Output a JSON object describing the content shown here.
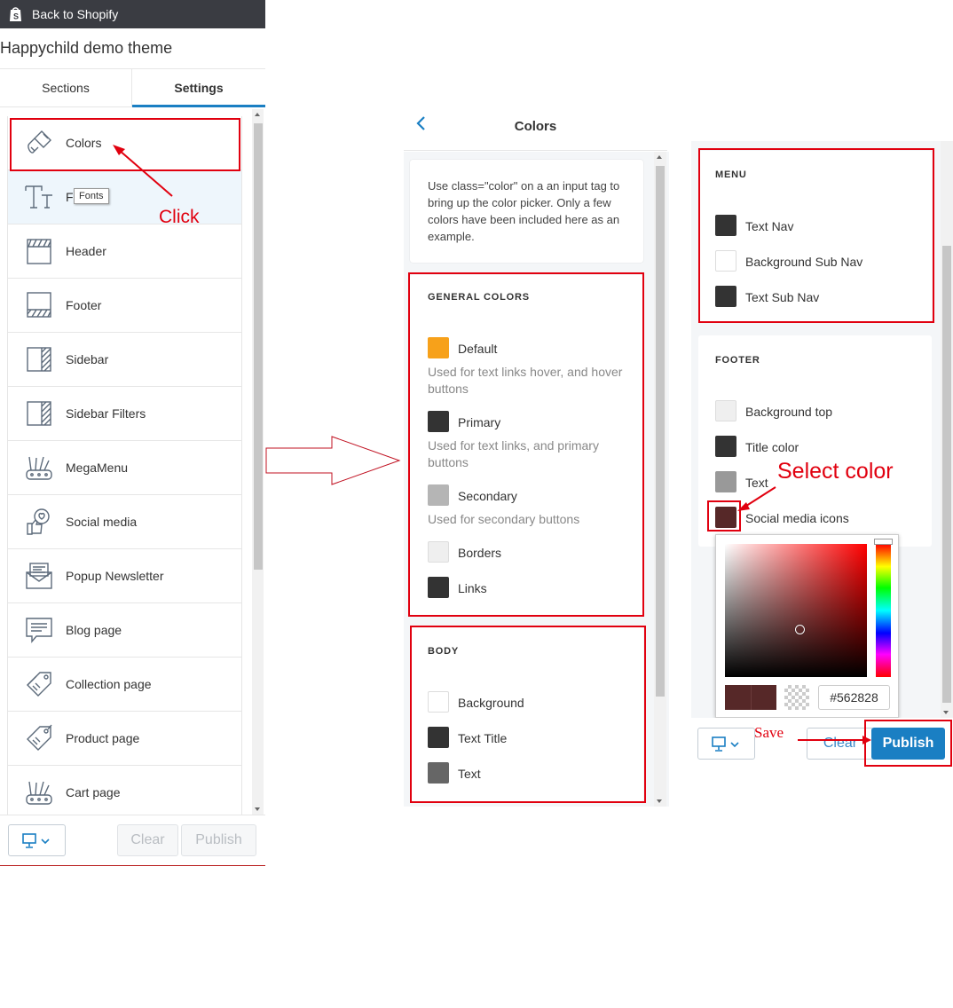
{
  "left_panel": {
    "back_link": "Back to Shopify",
    "theme_title": "Happychild demo theme",
    "tabs": [
      {
        "label": "Sections",
        "active": false
      },
      {
        "label": "Settings",
        "active": true
      }
    ],
    "menu_items": [
      {
        "label": "Colors",
        "icon": "brush-icon"
      },
      {
        "label": "F",
        "icon": "font-icon"
      },
      {
        "label": "Header",
        "icon": "header-icon"
      },
      {
        "label": "Footer",
        "icon": "footer-icon"
      },
      {
        "label": "Sidebar",
        "icon": "sidebar-icon"
      },
      {
        "label": "Sidebar Filters",
        "icon": "sidebar-filter-icon"
      },
      {
        "label": "MegaMenu",
        "icon": "megamenu-icon"
      },
      {
        "label": "Social media",
        "icon": "social-icon"
      },
      {
        "label": "Popup Newsletter",
        "icon": "newsletter-icon"
      },
      {
        "label": "Blog page",
        "icon": "blog-icon"
      },
      {
        "label": "Collection page",
        "icon": "tags-icon"
      },
      {
        "label": "Product page",
        "icon": "tag-icon"
      },
      {
        "label": "Cart page",
        "icon": "cart-icon"
      }
    ],
    "tooltip": "Fonts",
    "footer": {
      "clear": "Clear",
      "publish": "Publish"
    }
  },
  "colors_panel": {
    "title": "Colors",
    "info": "Use class=\"color\" on a an input tag to bring up the color picker. Only a few colors have been included here as an example.",
    "general": {
      "title": "GENERAL COLORS",
      "items": [
        {
          "label": "Default",
          "color": "#f7a11a",
          "help": "Used for text links hover, and hover buttons"
        },
        {
          "label": "Primary",
          "color": "#333333",
          "help": "Used for text links, and primary buttons"
        },
        {
          "label": "Secondary",
          "color": "#b5b5b5",
          "help": "Used for secondary buttons"
        },
        {
          "label": "Borders",
          "color": "#efefef",
          "help": ""
        },
        {
          "label": "Links",
          "color": "#333333",
          "help": ""
        }
      ]
    },
    "body": {
      "title": "BODY",
      "items": [
        {
          "label": "Background",
          "color": "#ffffff"
        },
        {
          "label": "Text Title",
          "color": "#333333"
        },
        {
          "label": "Text",
          "color": "#666666"
        }
      ]
    }
  },
  "right_panel": {
    "menu": {
      "title": "MENU",
      "items": [
        {
          "label": "Text Nav",
          "color": "#333333"
        },
        {
          "label": "Background Sub Nav",
          "color": "#ffffff"
        },
        {
          "label": "Text Sub Nav",
          "color": "#333333"
        }
      ]
    },
    "footer": {
      "title": "FOOTER",
      "items": [
        {
          "label": "Background top",
          "color": "#efefef"
        },
        {
          "label": "Title color",
          "color": "#333333"
        },
        {
          "label": "Text",
          "color": "#999999"
        },
        {
          "label": "Social media icons",
          "color": "#562828"
        }
      ]
    },
    "picker": {
      "hex": "#562828"
    },
    "buttons": {
      "clear": "Clear",
      "publish": "Publish"
    }
  },
  "annotations": {
    "click": "Click",
    "select_color": "Select color",
    "save": "Save"
  },
  "colors": {
    "accent": "#1a7fc3",
    "annotation_red": "#e1000f",
    "topbar": "#3a3c42"
  }
}
